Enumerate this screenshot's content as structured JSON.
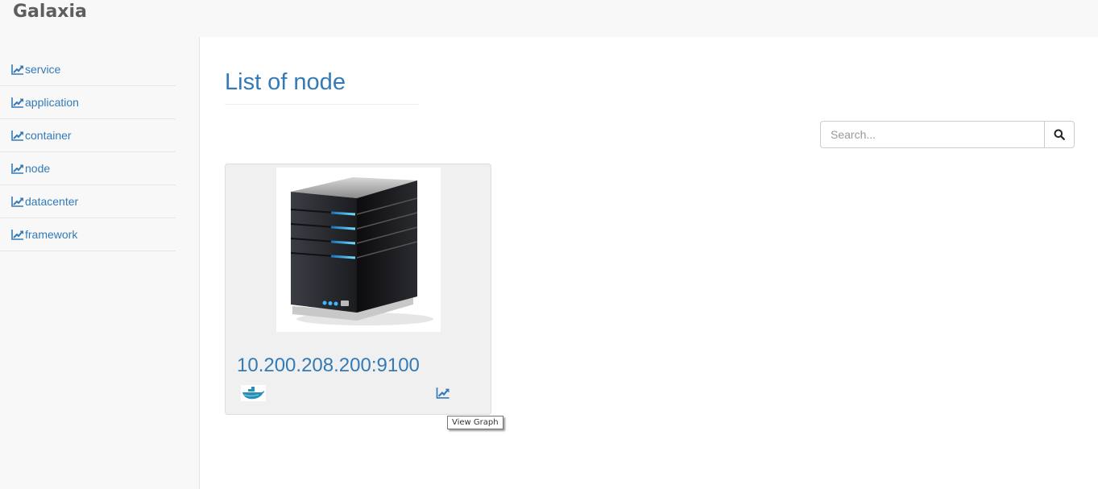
{
  "app": {
    "brand": "Galaxia"
  },
  "sidebar": {
    "items": [
      {
        "label": "service",
        "icon": "line-chart-icon"
      },
      {
        "label": "application",
        "icon": "line-chart-icon"
      },
      {
        "label": "container",
        "icon": "line-chart-icon"
      },
      {
        "label": "node",
        "icon": "line-chart-icon"
      },
      {
        "label": "datacenter",
        "icon": "line-chart-icon"
      },
      {
        "label": "framework",
        "icon": "line-chart-icon"
      }
    ]
  },
  "main": {
    "title": "List of node",
    "search": {
      "placeholder": "Search...",
      "value": "",
      "button_icon": "search-icon"
    },
    "nodes": [
      {
        "address": "10.200.208.200:9100",
        "image": "server-icon",
        "runtime_icon": "docker-whale-icon",
        "graph_icon": "line-chart-icon",
        "graph_tooltip": "View Graph"
      }
    ]
  },
  "colors": {
    "link": "#337ab7",
    "brand_text": "#5e5e5e",
    "sidebar_bg": "#f8f8f8",
    "card_bg": "#f0f0f0"
  }
}
